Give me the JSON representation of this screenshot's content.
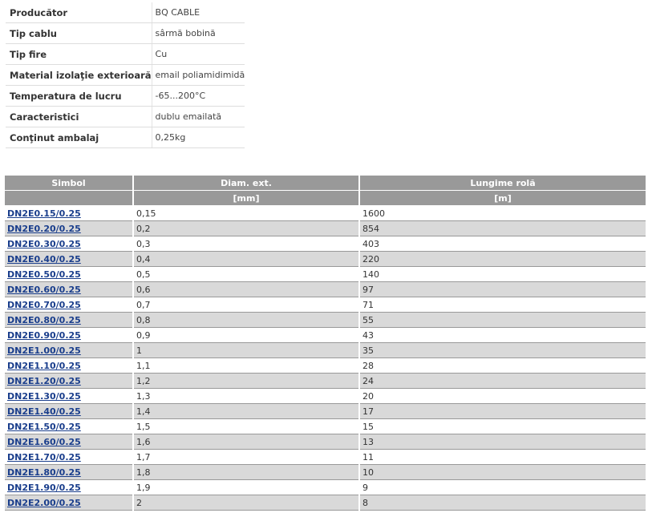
{
  "attributes": [
    {
      "name": "Producător",
      "value": "BQ CABLE"
    },
    {
      "name": "Tip cablu",
      "value": "sârmă bobină"
    },
    {
      "name": "Tip fire",
      "value": "Cu"
    },
    {
      "name": "Material izolaţie exterioară",
      "value": "email poliamidimidă"
    },
    {
      "name": "Temperatura de lucru",
      "value": "-65...200°C"
    },
    {
      "name": "Caracteristici",
      "value": "dublu emailată"
    },
    {
      "name": "Conţinut ambalaj",
      "value": "0,25kg"
    }
  ],
  "table": {
    "headers": [
      "Simbol",
      "Diam. ext.",
      "Lungime rolă"
    ],
    "units": [
      "",
      "[mm]",
      "[m]"
    ],
    "rows": [
      {
        "symbol": "DN2E0.15/0.25",
        "diam": "0,15",
        "length": "1600"
      },
      {
        "symbol": "DN2E0.20/0.25",
        "diam": "0,2",
        "length": "854"
      },
      {
        "symbol": "DN2E0.30/0.25",
        "diam": "0,3",
        "length": "403"
      },
      {
        "symbol": "DN2E0.40/0.25",
        "diam": "0,4",
        "length": "220"
      },
      {
        "symbol": "DN2E0.50/0.25",
        "diam": "0,5",
        "length": "140"
      },
      {
        "symbol": "DN2E0.60/0.25",
        "diam": "0,6",
        "length": "97"
      },
      {
        "symbol": "DN2E0.70/0.25",
        "diam": "0,7",
        "length": "71"
      },
      {
        "symbol": "DN2E0.80/0.25",
        "diam": "0,8",
        "length": "55"
      },
      {
        "symbol": "DN2E0.90/0.25",
        "diam": "0,9",
        "length": "43"
      },
      {
        "symbol": "DN2E1.00/0.25",
        "diam": "1",
        "length": "35"
      },
      {
        "symbol": "DN2E1.10/0.25",
        "diam": "1,1",
        "length": "28"
      },
      {
        "symbol": "DN2E1.20/0.25",
        "diam": "1,2",
        "length": "24"
      },
      {
        "symbol": "DN2E1.30/0.25",
        "diam": "1,3",
        "length": "20"
      },
      {
        "symbol": "DN2E1.40/0.25",
        "diam": "1,4",
        "length": "17"
      },
      {
        "symbol": "DN2E1.50/0.25",
        "diam": "1,5",
        "length": "15"
      },
      {
        "symbol": "DN2E1.60/0.25",
        "diam": "1,6",
        "length": "13"
      },
      {
        "symbol": "DN2E1.70/0.25",
        "diam": "1,7",
        "length": "11"
      },
      {
        "symbol": "DN2E1.80/0.25",
        "diam": "1,8",
        "length": "10"
      },
      {
        "symbol": "DN2E1.90/0.25",
        "diam": "1,9",
        "length": "9"
      },
      {
        "symbol": "DN2E2.00/0.25",
        "diam": "2",
        "length": "8"
      }
    ]
  }
}
